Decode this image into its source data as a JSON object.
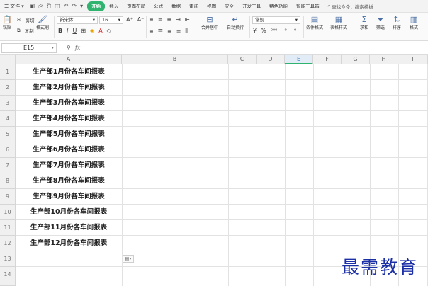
{
  "tabbar": {
    "file_label": "文件",
    "tabs": [
      {
        "label": "开始",
        "active": true
      },
      {
        "label": "插入",
        "active": false
      },
      {
        "label": "页面布局",
        "active": false
      },
      {
        "label": "公式",
        "active": false
      },
      {
        "label": "数据",
        "active": false
      },
      {
        "label": "审阅",
        "active": false
      },
      {
        "label": "视图",
        "active": false
      },
      {
        "label": "安全",
        "active": false
      },
      {
        "label": "开发工具",
        "active": false
      },
      {
        "label": "特色功能",
        "active": false
      },
      {
        "label": "智能工具箱",
        "active": false
      }
    ],
    "search_label": "查找命令、搜索模板"
  },
  "ribbon": {
    "paste": "粘贴",
    "cut": "剪切",
    "copy": "复制",
    "format_painter": "格式刷",
    "font_name": "新宋体",
    "font_size": "16",
    "merge_center": "合并居中",
    "auto_wrap": "自动换行",
    "number_format": "常规",
    "conditional_format": "条件格式",
    "table_style": "表格样式",
    "sum": "求和",
    "filter": "筛选",
    "sort": "排序",
    "format": "格式"
  },
  "formula_bar": {
    "cell_ref": "E15",
    "fx": "fx"
  },
  "columns": [
    "A",
    "B",
    "C",
    "D",
    "E",
    "F",
    "G",
    "H",
    "I"
  ],
  "selected_column": "E",
  "rows": [
    "1",
    "2",
    "3",
    "4",
    "5",
    "6",
    "7",
    "8",
    "9",
    "10",
    "11",
    "12",
    "13",
    "14"
  ],
  "cells_a": [
    "生产部1月份各车间报表",
    "生产部2月份各车间报表",
    "生产部3月份各车间报表",
    "生产部4月份各车间报表",
    "生产部5月份各车间报表",
    "生产部6月份各车间报表",
    "生产部7月份各车间报表",
    "生产部8月份各车间报表",
    "生产部9月份各车间报表",
    "生产部10月份各车间报表",
    "生产部11月份各车间报表",
    "生产部12月份各车间报表"
  ],
  "paste_options_label": "▾",
  "watermark": "最需教育",
  "colors": {
    "accent": "#2fb36f",
    "watermark": "#1b2fa6"
  }
}
